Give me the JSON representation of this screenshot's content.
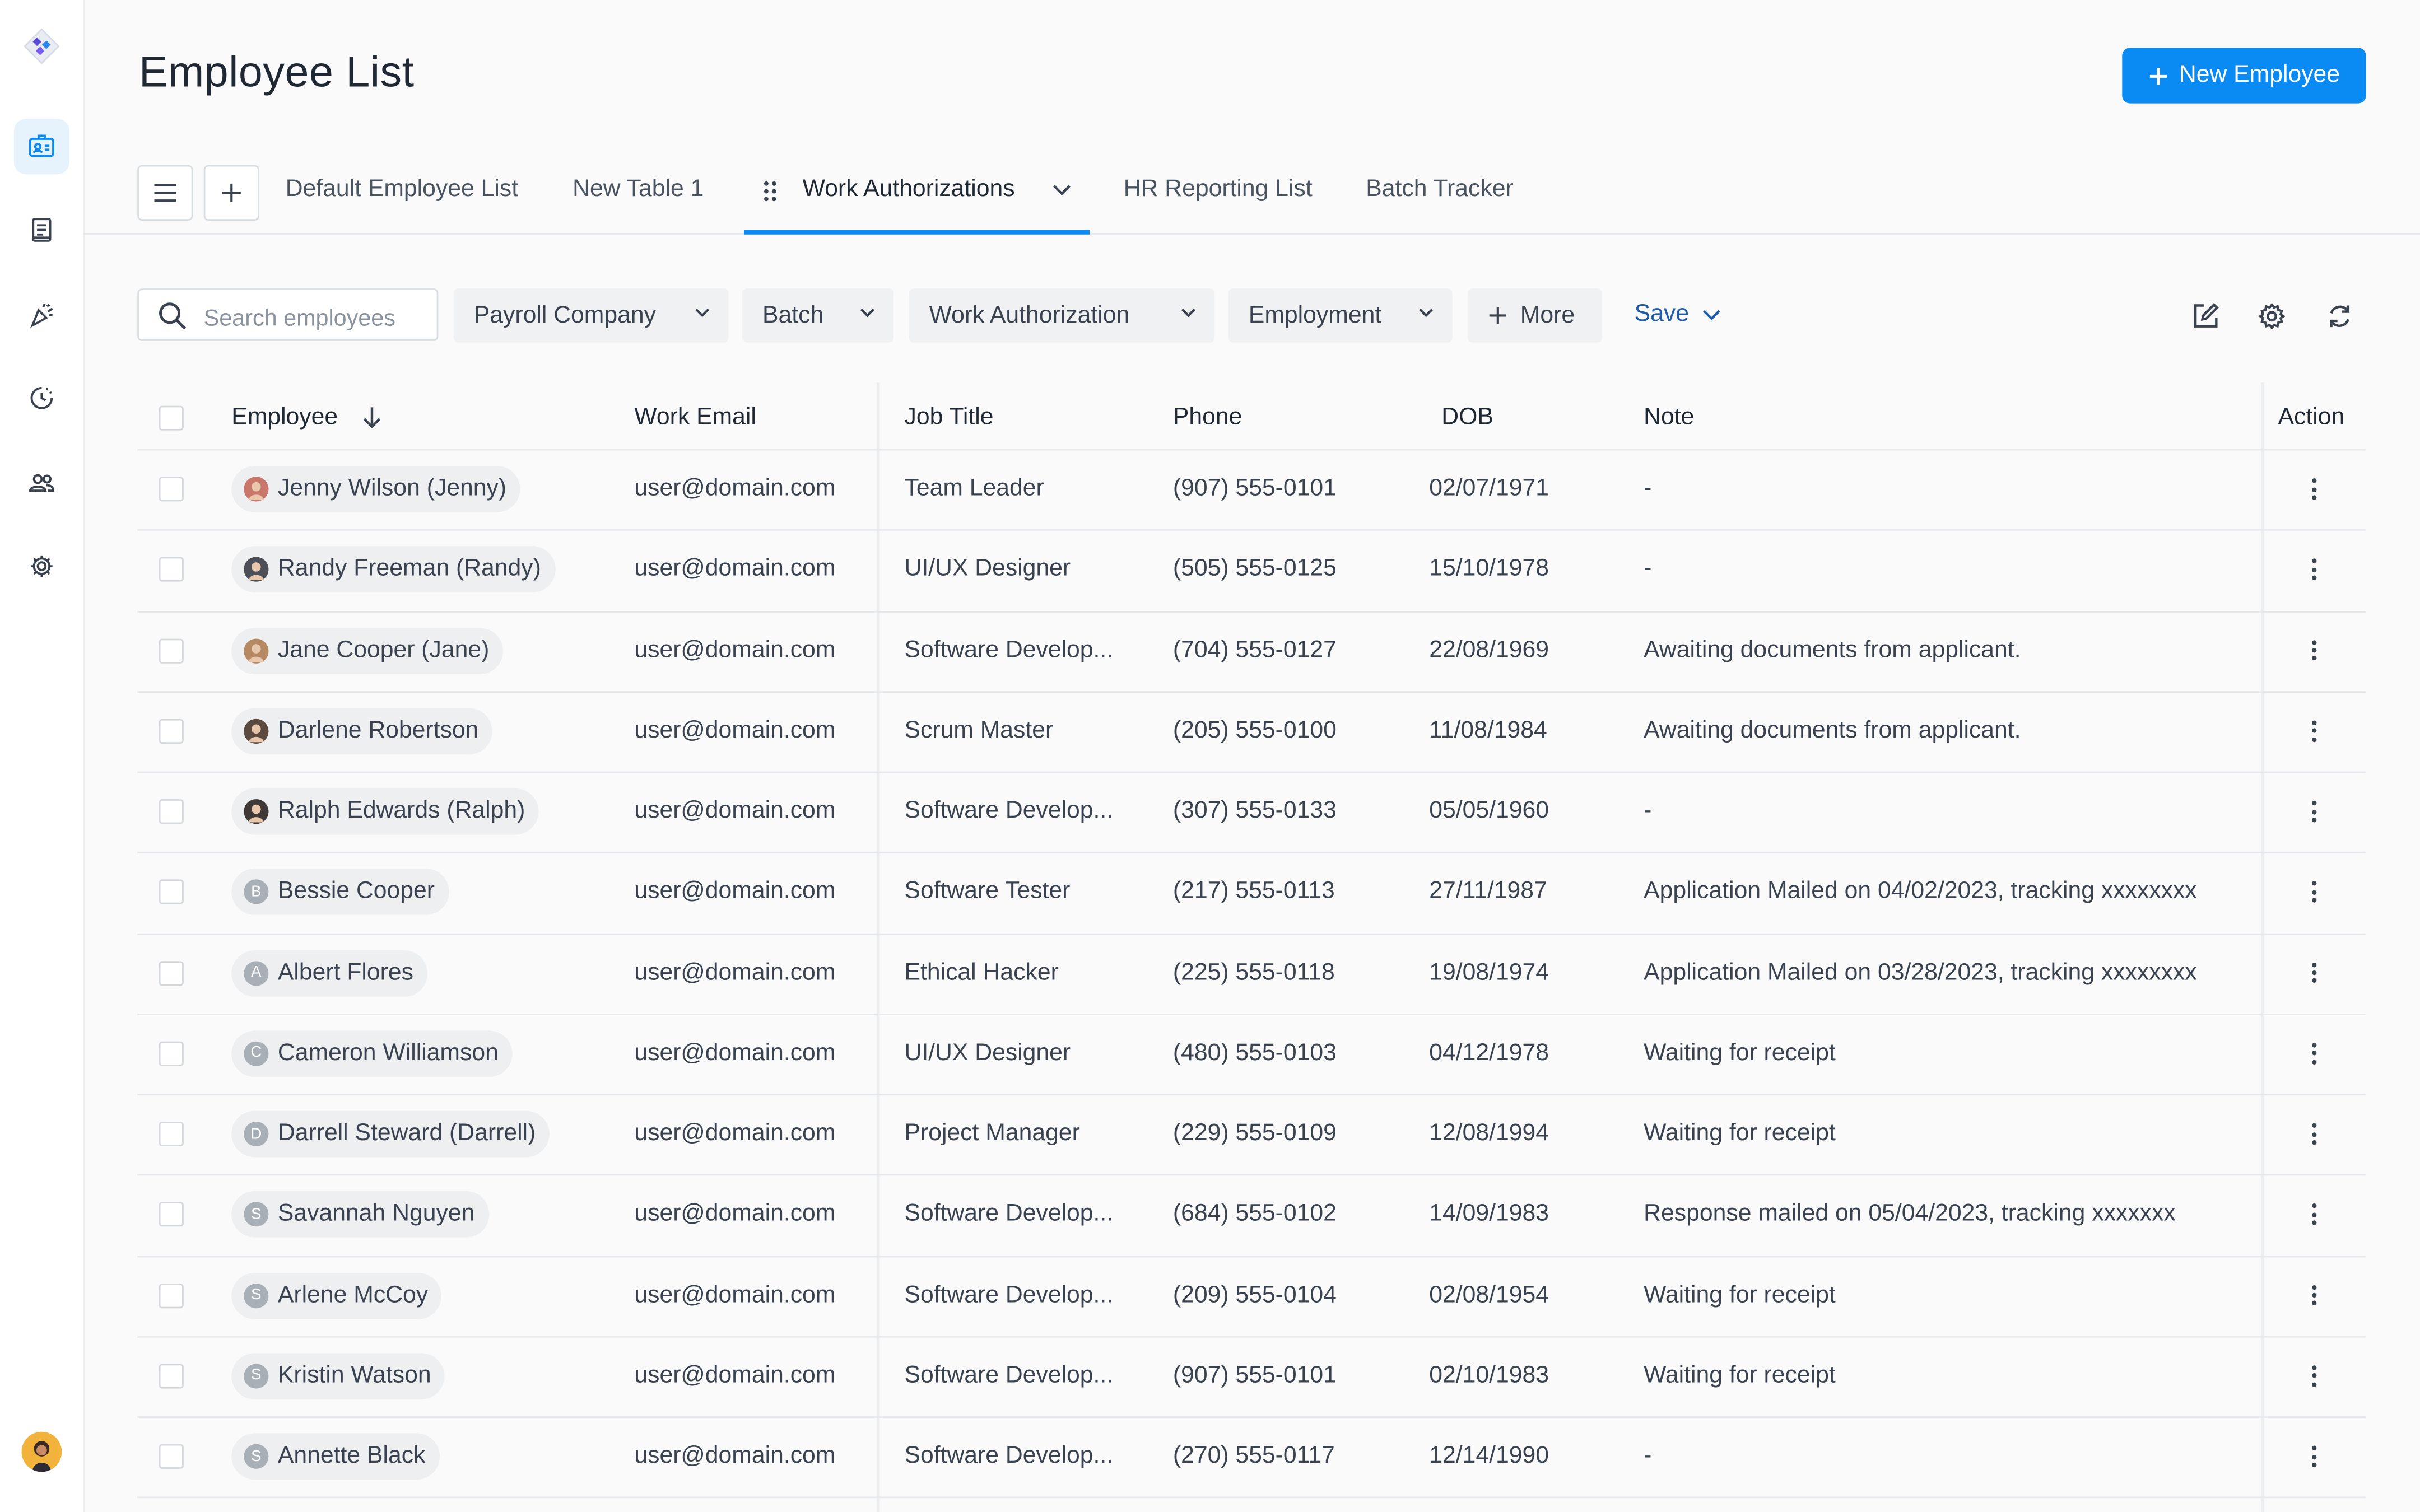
{
  "header": {
    "title": "Employee List",
    "new_button": "New Employee"
  },
  "sidebar": {
    "icons": [
      "logo-icon",
      "employee-badge-icon",
      "document-icon",
      "celebrate-icon",
      "time-off-icon",
      "people-icon",
      "settings-icon"
    ],
    "accent": "#0a8bf3"
  },
  "tabs": [
    {
      "label": "Default Employee List"
    },
    {
      "label": "New Table 1"
    },
    {
      "label": "Work Authorizations",
      "active": true
    },
    {
      "label": "HR Reporting List"
    },
    {
      "label": "Batch Tracker"
    }
  ],
  "search": {
    "placeholder": "Search employees"
  },
  "filters": [
    "Payroll Company",
    "Batch",
    "Work Authorization",
    "Employment"
  ],
  "more_label": "More",
  "save_label": "Save",
  "table": {
    "columns": [
      "Employee",
      "Work Email",
      "Job Title",
      "Phone",
      "DOB",
      "Note",
      "Action"
    ],
    "rows": [
      {
        "employee": "Jenny Wilson (Jenny)",
        "email": "user@domain.com",
        "job": "Team Leader",
        "phone": "(907) 555-0101",
        "dob": "02/07/1971",
        "note": "-",
        "avatar": "photo",
        "color": "#c9776b",
        "initial": ""
      },
      {
        "employee": "Randy Freeman (Randy)",
        "email": "user@domain.com",
        "job": "UI/UX Designer",
        "phone": "(505) 555-0125",
        "dob": "15/10/1978",
        "note": "-",
        "avatar": "photo",
        "color": "#4c4f58",
        "initial": ""
      },
      {
        "employee": "Jane Cooper (Jane)",
        "email": "user@domain.com",
        "job": "Software Develop...",
        "phone": "(704) 555-0127",
        "dob": "22/08/1969",
        "note": "Awaiting documents from applicant.",
        "avatar": "photo",
        "color": "#b58a63",
        "initial": ""
      },
      {
        "employee": "Darlene Robertson",
        "email": "user@domain.com",
        "job": "Scrum Master",
        "phone": "(205) 555-0100",
        "dob": "11/08/1984",
        "note": "Awaiting documents from applicant.",
        "avatar": "photo",
        "color": "#5b4a3f",
        "initial": ""
      },
      {
        "employee": "Ralph Edwards (Ralph)",
        "email": "user@domain.com",
        "job": "Software Develop...",
        "phone": "(307) 555-0133",
        "dob": "05/05/1960",
        "note": "-",
        "avatar": "photo",
        "color": "#3f3a38",
        "initial": ""
      },
      {
        "employee": "Bessie Cooper",
        "email": "user@domain.com",
        "job": "Software Tester",
        "phone": "(217) 555-0113",
        "dob": "27/11/1987",
        "note": "Application Mailed on 04/02/2023, tracking xxxxxxxx",
        "avatar": "initial",
        "color": "#a8afb7",
        "initial": "B"
      },
      {
        "employee": "Albert Flores",
        "email": "user@domain.com",
        "job": "Ethical Hacker",
        "phone": "(225) 555-0118",
        "dob": "19/08/1974",
        "note": "Application Mailed on 03/28/2023, tracking xxxxxxxx",
        "avatar": "initial",
        "color": "#a8afb7",
        "initial": "A"
      },
      {
        "employee": "Cameron Williamson",
        "email": "user@domain.com",
        "job": "UI/UX Designer",
        "phone": "(480) 555-0103",
        "dob": "04/12/1978",
        "note": "Waiting for receipt",
        "avatar": "initial",
        "color": "#a8afb7",
        "initial": "C"
      },
      {
        "employee": "Darrell Steward (Darrell)",
        "email": "user@domain.com",
        "job": "Project Manager",
        "phone": "(229) 555-0109",
        "dob": "12/08/1994",
        "note": "Waiting for receipt",
        "avatar": "initial",
        "color": "#a8afb7",
        "initial": "D"
      },
      {
        "employee": "Savannah Nguyen",
        "email": "user@domain.com",
        "job": "Software Develop...",
        "phone": "(684) 555-0102",
        "dob": "14/09/1983",
        "note": "Response mailed on 05/04/2023, tracking xxxxxxx",
        "avatar": "initial",
        "color": "#a8afb7",
        "initial": "S"
      },
      {
        "employee": "Arlene McCoy",
        "email": "user@domain.com",
        "job": "Software Develop...",
        "phone": "(209) 555-0104",
        "dob": "02/08/1954",
        "note": "Waiting for receipt",
        "avatar": "initial",
        "color": "#a8afb7",
        "initial": "S"
      },
      {
        "employee": "Kristin Watson",
        "email": "user@domain.com",
        "job": "Software Develop...",
        "phone": "(907) 555-0101",
        "dob": "02/10/1983",
        "note": "Waiting for receipt",
        "avatar": "initial",
        "color": "#a8afb7",
        "initial": "S"
      },
      {
        "employee": "Annette Black",
        "email": "user@domain.com",
        "job": "Software Develop...",
        "phone": "(270) 555-0117",
        "dob": "12/14/1990",
        "note": "-",
        "avatar": "initial",
        "color": "#a8afb7",
        "initial": "S"
      }
    ]
  }
}
